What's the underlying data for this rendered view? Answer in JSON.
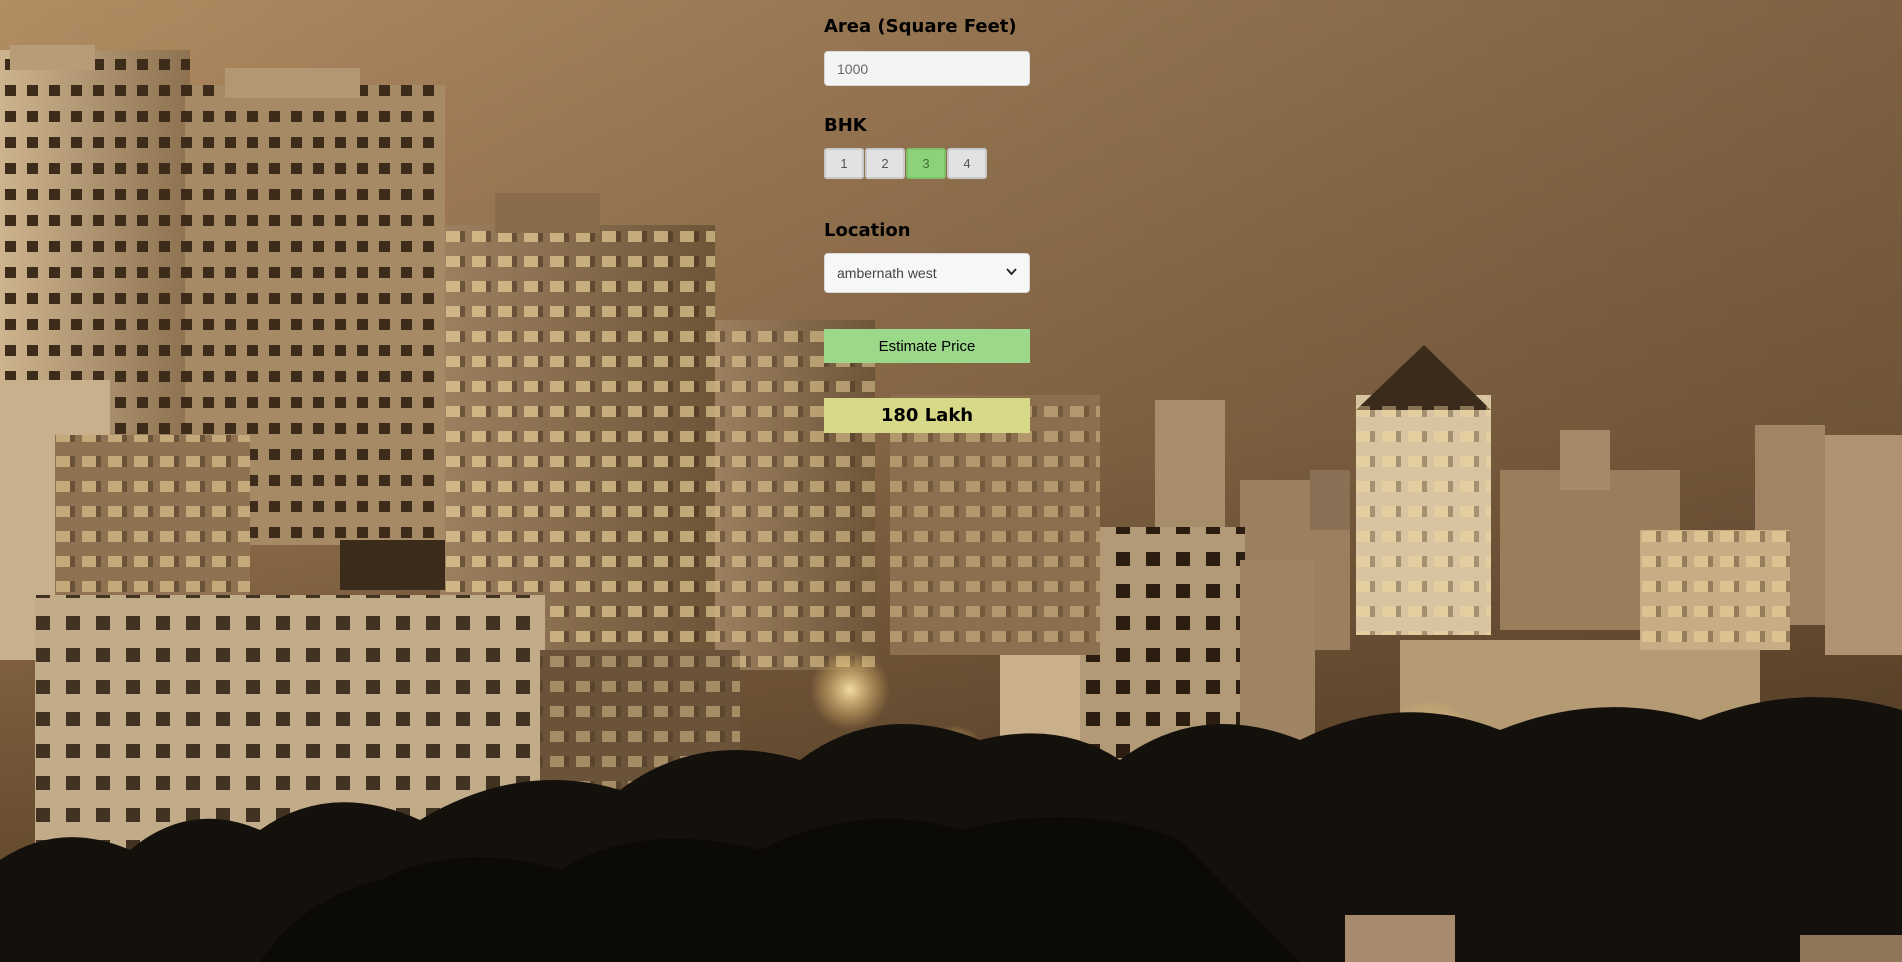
{
  "form": {
    "area_label": "Area (Square Feet)",
    "area_value": "1000",
    "bhk_label": "BHK",
    "bhk_options": [
      "1",
      "2",
      "3",
      "4"
    ],
    "bhk_selected": "3",
    "location_label": "Location",
    "location_selected": "ambernath west",
    "estimate_button": "Estimate Price",
    "result": "180 Lakh"
  },
  "colors": {
    "active_bhk": "#8ed17b",
    "estimate_button": "#9bd889",
    "result_background": "#d8d889"
  },
  "icons": {
    "select_arrow": "chevron-down-icon"
  }
}
